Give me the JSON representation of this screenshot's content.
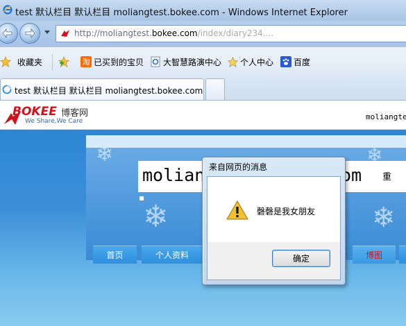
{
  "window": {
    "title": "test 默认栏目 默认栏目 moliangtest.bokee.com - Windows Internet Explorer"
  },
  "address_bar": {
    "url_prefix": "http://moliangtest.",
    "url_host": "bokee.com",
    "url_tail": "/index/diary234...."
  },
  "favorites_bar": {
    "favorites_label": "收藏夹",
    "items": [
      {
        "label": "已买到的宝贝",
        "icon": "taobao-icon"
      },
      {
        "label": "大智慧路演中心",
        "icon": "ie-page-icon"
      },
      {
        "label": "个人中心",
        "icon": "star-icon"
      },
      {
        "label": "百度",
        "icon": "baidu-paw-icon"
      }
    ]
  },
  "tabs": {
    "active_label": "test 默认栏目 默认栏目 moliangtest.bokee.com"
  },
  "site": {
    "logo_text": "BOKEE",
    "logo_cn": "博客网",
    "slogan": "We Share,We Care",
    "header_user": "moliangte"
  },
  "blog": {
    "title_text": "moliangtest.bokee.com",
    "title_edge": "重",
    "nav": {
      "home": "首页",
      "profile": "个人资料",
      "album": "博图"
    }
  },
  "dialog": {
    "title": "来自网页的消息",
    "message": "磬磬是我女朋友",
    "ok_label": "确定"
  },
  "colors": {
    "dialog_border": "#6f8fb7",
    "logo_red": "#d0121b",
    "nav_blue": "#2f8fdd"
  }
}
